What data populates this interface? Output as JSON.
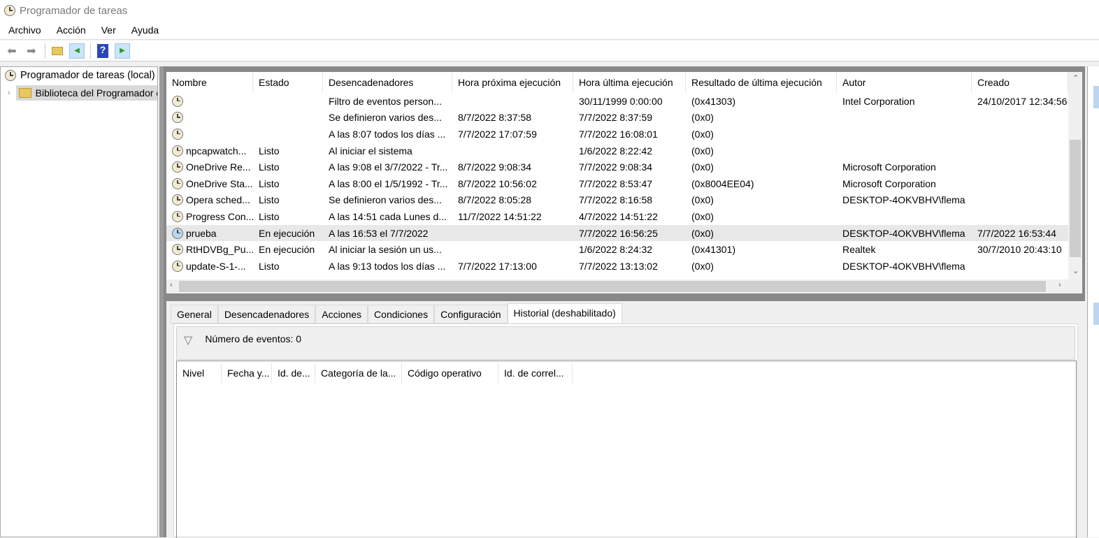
{
  "window": {
    "title": "Programador de tareas"
  },
  "menu": [
    "Archivo",
    "Acción",
    "Ver",
    "Ayuda"
  ],
  "tree": {
    "root": "Programador de tareas (local)",
    "child": "Biblioteca del Programador de tareas"
  },
  "table": {
    "columns": [
      "Nombre",
      "Estado",
      "Desencadenadores",
      "Hora próxima ejecución",
      "Hora última ejecución",
      "Resultado de última ejecución",
      "Autor",
      "Creado"
    ],
    "rows": [
      {
        "icon": "clock-icon",
        "cells": [
          "",
          "",
          "Filtro de eventos person...",
          "",
          "30/11/1999 0:00:00",
          "(0x41303)",
          "Intel Corporation",
          "24/10/2017 12:34:56"
        ]
      },
      {
        "icon": "clock-icon",
        "cells": [
          "",
          "",
          "Se definieron varios des...",
          "8/7/2022 8:37:58",
          "7/7/2022 8:37:59",
          "(0x0)",
          "",
          ""
        ]
      },
      {
        "icon": "clock-icon",
        "cells": [
          "",
          "",
          "A las 8:07 todos los días ...",
          "7/7/2022 17:07:59",
          "7/7/2022 16:08:01",
          "(0x0)",
          "",
          ""
        ]
      },
      {
        "icon": "clock-icon",
        "cells": [
          "npcapwatch...",
          "Listo",
          "Al iniciar el sistema",
          "",
          "1/6/2022 8:22:42",
          "(0x0)",
          "",
          ""
        ]
      },
      {
        "icon": "clock-icon",
        "cells": [
          "OneDrive Re...",
          "Listo",
          "A las 9:08 el 3/7/2022 - Tr...",
          "8/7/2022 9:08:34",
          "7/7/2022 9:08:34",
          "(0x0)",
          "Microsoft Corporation",
          ""
        ]
      },
      {
        "icon": "clock-icon",
        "cells": [
          "OneDrive Sta...",
          "Listo",
          "A las 8:00 el 1/5/1992 - Tr...",
          "8/7/2022 10:56:02",
          "7/7/2022 8:53:47",
          "(0x8004EE04)",
          "Microsoft Corporation",
          ""
        ]
      },
      {
        "icon": "clock-icon",
        "cells": [
          "Opera sched...",
          "Listo",
          "Se definieron varios des...",
          "8/7/2022 8:05:28",
          "7/7/2022 8:16:58",
          "(0x0)",
          "DESKTOP-4OKVBHV\\flema",
          ""
        ]
      },
      {
        "icon": "clock-icon",
        "cells": [
          "Progress Con...",
          "Listo",
          "A las 14:51 cada Lunes d...",
          "11/7/2022 14:51:22",
          "4/7/2022 14:51:22",
          "(0x0)",
          "",
          ""
        ]
      },
      {
        "icon": "clock-running-icon",
        "selected": true,
        "cells": [
          "prueba",
          "En ejecución",
          "A las 16:53 el 7/7/2022",
          "",
          "7/7/2022 16:56:25",
          "(0x0)",
          "DESKTOP-4OKVBHV\\flema",
          "7/7/2022 16:53:44"
        ]
      },
      {
        "icon": "clock-icon",
        "cells": [
          "RtHDVBg_Pu...",
          "En ejecución",
          "Al iniciar la sesión un us...",
          "",
          "1/6/2022 8:24:32",
          "(0x41301)",
          "Realtek",
          "30/7/2010 20:43:10"
        ]
      },
      {
        "icon": "clock-icon",
        "cells": [
          "update-S-1-...",
          "Listo",
          "A las 9:13 todos los días ...",
          "7/7/2022 17:13:00",
          "7/7/2022 13:13:02",
          "(0x0)",
          "DESKTOP-4OKVBHV\\flema",
          ""
        ]
      }
    ]
  },
  "tabs": [
    {
      "label": "General"
    },
    {
      "label": "Desencadenadores"
    },
    {
      "label": "Acciones"
    },
    {
      "label": "Condiciones"
    },
    {
      "label": "Configuración"
    },
    {
      "label": "Historial (deshabilitado)",
      "active": true
    }
  ],
  "history": {
    "event_count": "Número de eventos: 0",
    "columns": [
      "Nivel",
      "Fecha y...",
      "Id. de...",
      "Categoría de la...",
      "Código operativo",
      "Id. de correl..."
    ]
  }
}
